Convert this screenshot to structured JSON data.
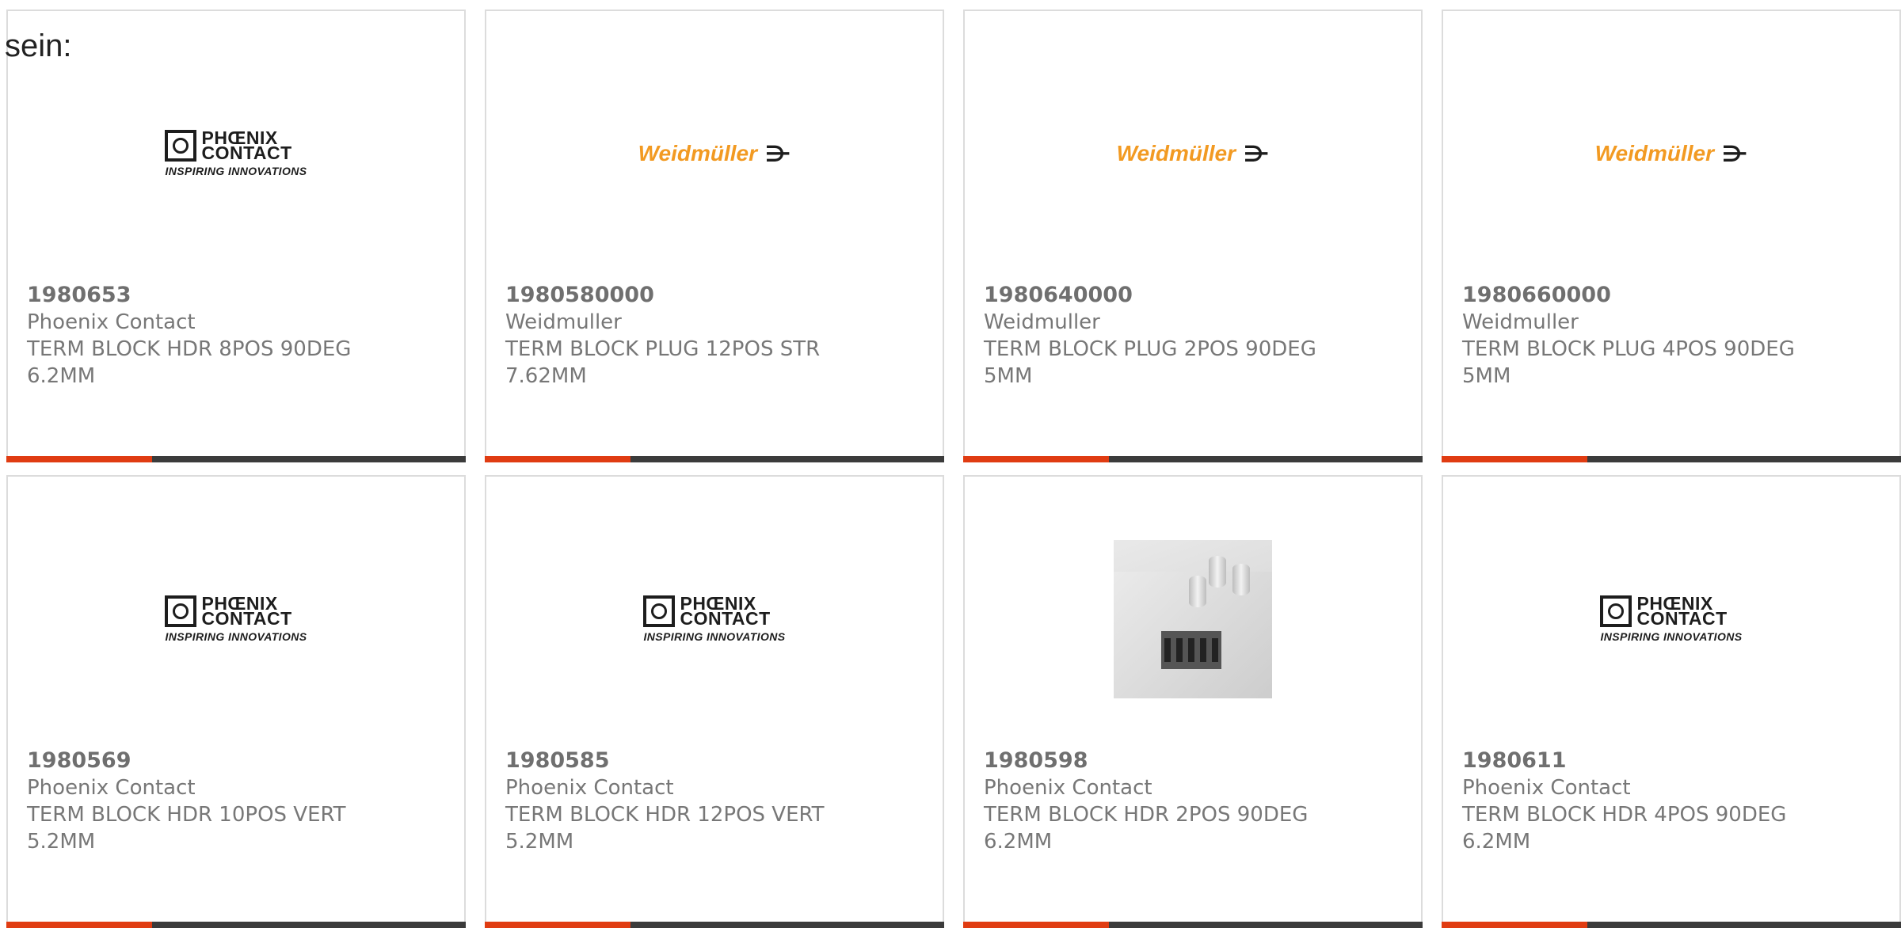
{
  "intro_text": "sein:",
  "colors": {
    "accent": "#e03c12",
    "bar": "#3b3b3b",
    "weidmuller_orange": "#f29a22"
  },
  "logos": {
    "phoenix": {
      "line1": "PHŒNIX",
      "line2": "CONTACT",
      "tagline": "INSPIRING INNOVATIONS"
    },
    "weidmuller": {
      "name": "Weidmüller",
      "symbol": "⋺"
    }
  },
  "products": [
    {
      "part_number": "1980653",
      "manufacturer": "Phoenix Contact",
      "description": "TERM BLOCK HDR 8POS 90DEG\n6.2MM",
      "media": "phoenix-logo"
    },
    {
      "part_number": "1980580000",
      "manufacturer": "Weidmuller",
      "description": "TERM BLOCK PLUG 12POS STR\n7.62MM",
      "media": "weidmuller-logo"
    },
    {
      "part_number": "1980640000",
      "manufacturer": "Weidmuller",
      "description": "TERM BLOCK PLUG 2POS 90DEG\n5MM",
      "media": "weidmuller-logo"
    },
    {
      "part_number": "1980660000",
      "manufacturer": "Weidmuller",
      "description": "TERM BLOCK PLUG 4POS 90DEG\n5MM",
      "media": "weidmuller-logo"
    },
    {
      "part_number": "1980569",
      "manufacturer": "Phoenix Contact",
      "description": "TERM BLOCK HDR 10POS VERT\n5.2MM",
      "media": "phoenix-logo"
    },
    {
      "part_number": "1980585",
      "manufacturer": "Phoenix Contact",
      "description": "TERM BLOCK HDR 12POS VERT\n5.2MM",
      "media": "phoenix-logo"
    },
    {
      "part_number": "1980598",
      "manufacturer": "Phoenix Contact",
      "description": "TERM BLOCK HDR 2POS 90DEG\n6.2MM",
      "media": "product-photo"
    },
    {
      "part_number": "1980611",
      "manufacturer": "Phoenix Contact",
      "description": "TERM BLOCK HDR 4POS 90DEG\n6.2MM",
      "media": "phoenix-logo"
    }
  ]
}
